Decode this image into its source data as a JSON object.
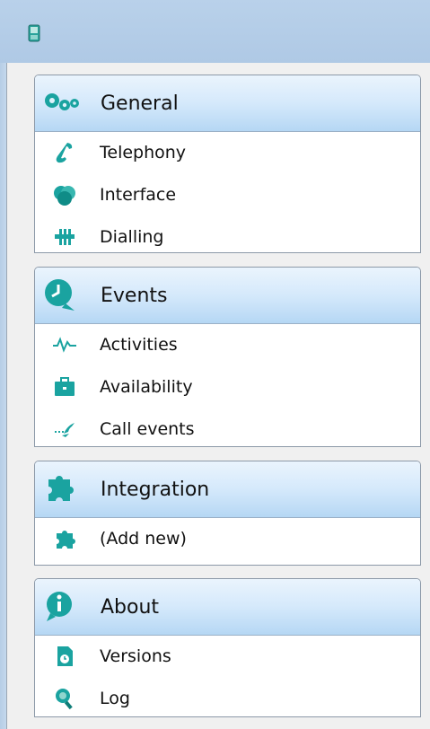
{
  "window": {
    "app_icon": "phone-app-icon"
  },
  "groups": [
    {
      "title": "General",
      "icon": "gears-icon",
      "items": [
        {
          "label": "Telephony",
          "icon": "phone-handset-icon"
        },
        {
          "label": "Interface",
          "icon": "interface-icon"
        },
        {
          "label": "Dialling",
          "icon": "keypad-icon"
        }
      ]
    },
    {
      "title": "Events",
      "icon": "clock-bubble-icon",
      "items": [
        {
          "label": "Activities",
          "icon": "pulse-icon"
        },
        {
          "label": "Availability",
          "icon": "briefcase-icon"
        },
        {
          "label": "Call events",
          "icon": "call-arrow-icon"
        }
      ]
    },
    {
      "title": "Integration",
      "icon": "puzzle-icon",
      "items": [
        {
          "label": "(Add new)",
          "icon": "puzzle-add-icon"
        }
      ]
    },
    {
      "title": "About",
      "icon": "info-bubble-icon",
      "items": [
        {
          "label": "Versions",
          "icon": "document-clock-icon"
        },
        {
          "label": "Log",
          "icon": "magnifier-icon"
        }
      ]
    }
  ],
  "colors": {
    "accent": "#1aa3a0",
    "header_light": "#eaf4fd",
    "header_dark": "#b5d7f4"
  }
}
